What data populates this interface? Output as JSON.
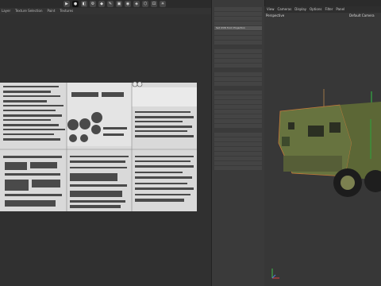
{
  "menu_left": [
    "Layer",
    "Texture Selection",
    "Paint",
    "Textures"
  ],
  "viewport": {
    "menu": [
      "View",
      "Cameras",
      "Display",
      "Options",
      "Filter",
      "Panel"
    ],
    "view_name": "Perspective",
    "camera": "Default Camera"
  },
  "mid_panel": {
    "highlighted": "Set UVW from Projection"
  },
  "icons": [
    "play-icon",
    "record-icon",
    "render-icon",
    "render-settings-icon",
    "cube-icon",
    "pen-icon",
    "subdivide-icon",
    "cloner-icon",
    "deformer-icon",
    "scene-icon",
    "camera-icon",
    "light-icon"
  ]
}
